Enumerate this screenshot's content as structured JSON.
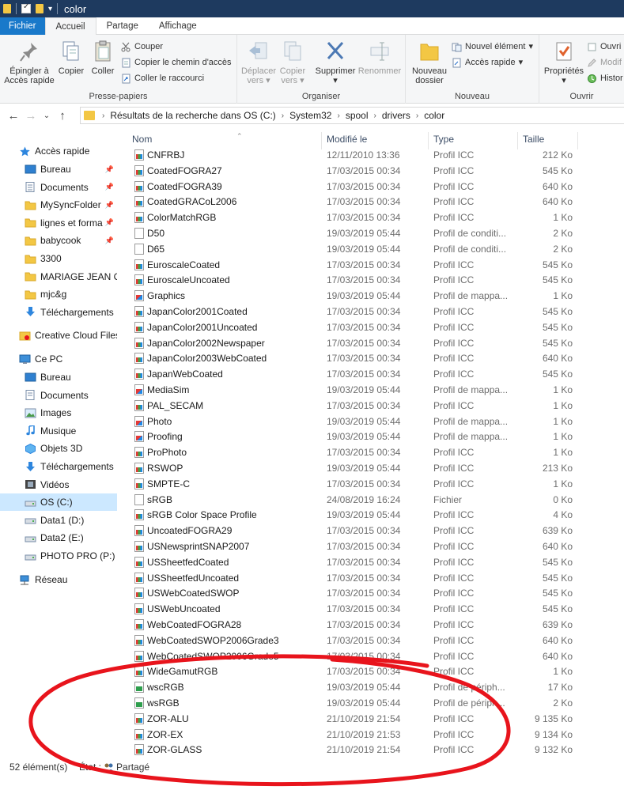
{
  "window": {
    "title": "color"
  },
  "ribbon_tabs": [
    "Fichier",
    "Accueil",
    "Partage",
    "Affichage"
  ],
  "ribbon": {
    "pin_label_1": "Épingler à",
    "pin_label_2": "Accès rapide",
    "copy_label": "Copier",
    "paste_label": "Coller",
    "cut_label": "Couper",
    "copy_path_label": "Copier le chemin d'accès",
    "paste_shortcut_label": "Coller le raccourci",
    "group_clipboard": "Presse-papiers",
    "move_label_1": "Déplacer",
    "move_label_2": "vers",
    "copyto_label_1": "Copier",
    "copyto_label_2": "vers",
    "delete_label": "Supprimer",
    "rename_label": "Renommer",
    "group_organize": "Organiser",
    "new_folder_label_1": "Nouveau",
    "new_folder_label_2": "dossier",
    "new_item_label": "Nouvel élément",
    "easy_access_label": "Accès rapide",
    "group_new": "Nouveau",
    "properties_label": "Propriétés",
    "open_label": "Ouvri",
    "edit_label": "Modif",
    "history_label": "Histor",
    "group_open": "Ouvrir"
  },
  "address": {
    "crumbs": [
      "Résultats de la recherche dans OS (C:)",
      "System32",
      "spool",
      "drivers",
      "color"
    ]
  },
  "nav": {
    "quick_access": "Accès rapide",
    "quick_items": [
      "Bureau",
      "Documents",
      "MySyncFolder",
      "lignes et forma",
      "babycook",
      "3300",
      "MARIAGE JEAN CI",
      "mjc&g",
      "Téléchargements"
    ],
    "creative_cloud": "Creative Cloud Files",
    "this_pc": "Ce PC",
    "pc_items": [
      "Bureau",
      "Documents",
      "Images",
      "Musique",
      "Objets 3D",
      "Téléchargements",
      "Vidéos",
      "OS (C:)",
      "Data1 (D:)",
      "Data2 (E:)",
      "PHOTO PRO (P:)"
    ],
    "network": "Réseau"
  },
  "columns": {
    "name": "Nom",
    "modified": "Modifié le",
    "type": "Type",
    "size": "Taille"
  },
  "files": [
    {
      "name": "CNFRBJ",
      "date": "12/11/2010 13:36",
      "type": "Profil ICC",
      "size": "212 Ko",
      "icon": "icc"
    },
    {
      "name": "CoatedFOGRA27",
      "date": "17/03/2015 00:34",
      "type": "Profil ICC",
      "size": "545 Ko",
      "icon": "icc"
    },
    {
      "name": "CoatedFOGRA39",
      "date": "17/03/2015 00:34",
      "type": "Profil ICC",
      "size": "640 Ko",
      "icon": "icc"
    },
    {
      "name": "CoatedGRACoL2006",
      "date": "17/03/2015 00:34",
      "type": "Profil ICC",
      "size": "640 Ko",
      "icon": "icc"
    },
    {
      "name": "ColorMatchRGB",
      "date": "17/03/2015 00:34",
      "type": "Profil ICC",
      "size": "1 Ko",
      "icon": "icc"
    },
    {
      "name": "D50",
      "date": "19/03/2019 05:44",
      "type": "Profil de conditi...",
      "size": "2 Ko",
      "icon": "blank"
    },
    {
      "name": "D65",
      "date": "19/03/2019 05:44",
      "type": "Profil de conditi...",
      "size": "2 Ko",
      "icon": "blank"
    },
    {
      "name": "EuroscaleCoated",
      "date": "17/03/2015 00:34",
      "type": "Profil ICC",
      "size": "545 Ko",
      "icon": "icc"
    },
    {
      "name": "EuroscaleUncoated",
      "date": "17/03/2015 00:34",
      "type": "Profil ICC",
      "size": "545 Ko",
      "icon": "icc"
    },
    {
      "name": "Graphics",
      "date": "19/03/2019 05:44",
      "type": "Profil de mappa...",
      "size": "1 Ko",
      "icon": "red"
    },
    {
      "name": "JapanColor2001Coated",
      "date": "17/03/2015 00:34",
      "type": "Profil ICC",
      "size": "545 Ko",
      "icon": "icc"
    },
    {
      "name": "JapanColor2001Uncoated",
      "date": "17/03/2015 00:34",
      "type": "Profil ICC",
      "size": "545 Ko",
      "icon": "icc"
    },
    {
      "name": "JapanColor2002Newspaper",
      "date": "17/03/2015 00:34",
      "type": "Profil ICC",
      "size": "545 Ko",
      "icon": "icc"
    },
    {
      "name": "JapanColor2003WebCoated",
      "date": "17/03/2015 00:34",
      "type": "Profil ICC",
      "size": "640 Ko",
      "icon": "icc"
    },
    {
      "name": "JapanWebCoated",
      "date": "17/03/2015 00:34",
      "type": "Profil ICC",
      "size": "545 Ko",
      "icon": "icc"
    },
    {
      "name": "MediaSim",
      "date": "19/03/2019 05:44",
      "type": "Profil de mappa...",
      "size": "1 Ko",
      "icon": "red"
    },
    {
      "name": "PAL_SECAM",
      "date": "17/03/2015 00:34",
      "type": "Profil ICC",
      "size": "1 Ko",
      "icon": "icc"
    },
    {
      "name": "Photo",
      "date": "19/03/2019 05:44",
      "type": "Profil de mappa...",
      "size": "1 Ko",
      "icon": "red"
    },
    {
      "name": "Proofing",
      "date": "19/03/2019 05:44",
      "type": "Profil de mappa...",
      "size": "1 Ko",
      "icon": "red"
    },
    {
      "name": "ProPhoto",
      "date": "17/03/2015 00:34",
      "type": "Profil ICC",
      "size": "1 Ko",
      "icon": "icc"
    },
    {
      "name": "RSWOP",
      "date": "19/03/2019 05:44",
      "type": "Profil ICC",
      "size": "213 Ko",
      "icon": "icc"
    },
    {
      "name": "SMPTE-C",
      "date": "17/03/2015 00:34",
      "type": "Profil ICC",
      "size": "1 Ko",
      "icon": "icc"
    },
    {
      "name": "sRGB",
      "date": "24/08/2019 16:24",
      "type": "Fichier",
      "size": "0 Ko",
      "icon": "blank"
    },
    {
      "name": "sRGB Color Space Profile",
      "date": "19/03/2019 05:44",
      "type": "Profil ICC",
      "size": "4 Ko",
      "icon": "icc"
    },
    {
      "name": "UncoatedFOGRA29",
      "date": "17/03/2015 00:34",
      "type": "Profil ICC",
      "size": "639 Ko",
      "icon": "icc"
    },
    {
      "name": "USNewsprintSNAP2007",
      "date": "17/03/2015 00:34",
      "type": "Profil ICC",
      "size": "640 Ko",
      "icon": "icc"
    },
    {
      "name": "USSheetfedCoated",
      "date": "17/03/2015 00:34",
      "type": "Profil ICC",
      "size": "545 Ko",
      "icon": "icc"
    },
    {
      "name": "USSheetfedUncoated",
      "date": "17/03/2015 00:34",
      "type": "Profil ICC",
      "size": "545 Ko",
      "icon": "icc"
    },
    {
      "name": "USWebCoatedSWOP",
      "date": "17/03/2015 00:34",
      "type": "Profil ICC",
      "size": "545 Ko",
      "icon": "icc"
    },
    {
      "name": "USWebUncoated",
      "date": "17/03/2015 00:34",
      "type": "Profil ICC",
      "size": "545 Ko",
      "icon": "icc"
    },
    {
      "name": "WebCoatedFOGRA28",
      "date": "17/03/2015 00:34",
      "type": "Profil ICC",
      "size": "639 Ko",
      "icon": "icc"
    },
    {
      "name": "WebCoatedSWOP2006Grade3",
      "date": "17/03/2015 00:34",
      "type": "Profil ICC",
      "size": "640 Ko",
      "icon": "icc"
    },
    {
      "name": "WebCoatedSWOP2006Grade5",
      "date": "17/03/2015 00:34",
      "type": "Profil ICC",
      "size": "640 Ko",
      "icon": "icc"
    },
    {
      "name": "WideGamutRGB",
      "date": "17/03/2015 00:34",
      "type": "Profil ICC",
      "size": "1 Ko",
      "icon": "icc"
    },
    {
      "name": "wscRGB",
      "date": "19/03/2019 05:44",
      "type": "Profil de périph...",
      "size": "17 Ko",
      "icon": "green"
    },
    {
      "name": "wsRGB",
      "date": "19/03/2019 05:44",
      "type": "Profil de périph...",
      "size": "2 Ko",
      "icon": "green"
    },
    {
      "name": "ZOR-ALU",
      "date": "21/10/2019 21:54",
      "type": "Profil ICC",
      "size": "9 135 Ko",
      "icon": "icc"
    },
    {
      "name": "ZOR-EX",
      "date": "21/10/2019 21:53",
      "type": "Profil ICC",
      "size": "9 134 Ko",
      "icon": "icc"
    },
    {
      "name": "ZOR-GLASS",
      "date": "21/10/2019 21:54",
      "type": "Profil ICC",
      "size": "9 132 Ko",
      "icon": "icc"
    }
  ],
  "status": {
    "count": "52 élément(s)",
    "state": "État :",
    "share": "Partagé"
  },
  "colors": {
    "titlebar": "#1e3a5f",
    "file_tab": "#1979ca",
    "selection": "#cce8ff",
    "annotation": "#e8141c"
  }
}
